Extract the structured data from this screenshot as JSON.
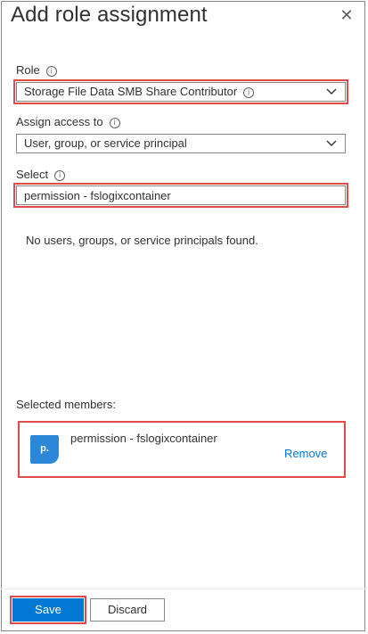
{
  "panel": {
    "title": "Add role assignment",
    "close_icon": "close-icon"
  },
  "role": {
    "label": "Role",
    "value": "Storage File Data SMB Share Contributor"
  },
  "assign_access": {
    "label": "Assign access to",
    "value": "User, group, or service principal"
  },
  "select": {
    "label": "Select",
    "value": "permission - fslogixcontainer"
  },
  "results": {
    "message": "No users, groups, or service principals found."
  },
  "selected_members": {
    "label": "Selected members:",
    "items": [
      {
        "initials": "p.",
        "name": "permission - fslogixcontainer",
        "remove_label": "Remove"
      }
    ]
  },
  "footer": {
    "save_label": "Save",
    "discard_label": "Discard"
  },
  "colors": {
    "accent": "#0078d4",
    "highlight": "#e04b4b",
    "avatar": "#2b88d8"
  }
}
